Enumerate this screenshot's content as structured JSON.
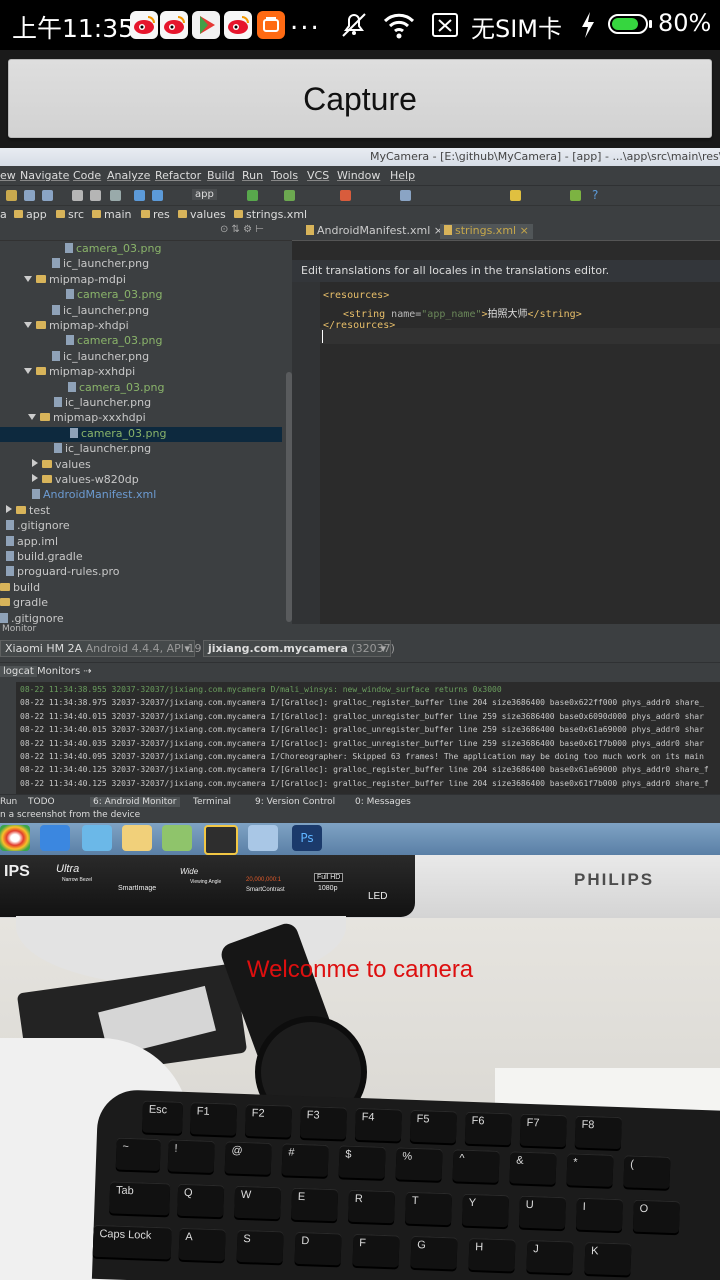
{
  "status_bar": {
    "time": "上午11:35",
    "notification_icons": [
      "weibo-icon",
      "weibo-icon",
      "play-store-icon",
      "weibo-icon",
      "taobao-icon"
    ],
    "overflow_dots": "...",
    "sim_status": "无SIM卡",
    "battery_percent": "80%",
    "battery_level": 0.8,
    "battery_color": "#36d63f"
  },
  "capture_button": {
    "label": "Capture"
  },
  "camera_overlay": {
    "text": "Welconme to camera",
    "color": "#dd0f0f"
  },
  "preview": {
    "ide": {
      "window_title": "MyCamera - [E:\\github\\MyCamera] - [app] - ...\\app\\src\\main\\res\\",
      "menu": [
        "ew",
        "Navigate",
        "Code",
        "Analyze",
        "Refactor",
        "Build",
        "Run",
        "Tools",
        "VCS",
        "Window",
        "Help"
      ],
      "toolbar_app": "app",
      "breadcrumb": [
        "a",
        "app",
        "src",
        "main",
        "res",
        "values",
        "strings.xml"
      ],
      "project_tree": [
        {
          "label": "camera_03.png",
          "type": "file",
          "highlight": true
        },
        {
          "label": "ic_launcher.png",
          "type": "file"
        },
        {
          "label": "mipmap-mdpi",
          "type": "folder-open"
        },
        {
          "label": "camera_03.png",
          "type": "file",
          "highlight": true
        },
        {
          "label": "ic_launcher.png",
          "type": "file"
        },
        {
          "label": "mipmap-xhdpi",
          "type": "folder-open"
        },
        {
          "label": "camera_03.png",
          "type": "file",
          "highlight": true
        },
        {
          "label": "ic_launcher.png",
          "type": "file"
        },
        {
          "label": "mipmap-xxhdpi",
          "type": "folder-open"
        },
        {
          "label": "camera_03.png",
          "type": "file",
          "highlight": true
        },
        {
          "label": "ic_launcher.png",
          "type": "file"
        },
        {
          "label": "mipmap-xxxhdpi",
          "type": "folder-open"
        },
        {
          "label": "camera_03.png",
          "type": "file",
          "highlight": true,
          "selected": true
        },
        {
          "label": "ic_launcher.png",
          "type": "file"
        },
        {
          "label": "values",
          "type": "folder-closed"
        },
        {
          "label": "values-w820dp",
          "type": "folder-closed"
        },
        {
          "label": "AndroidManifest.xml",
          "type": "file",
          "blue": true
        },
        {
          "label": "test",
          "type": "folder-closed"
        },
        {
          "label": ".gitignore",
          "type": "file"
        },
        {
          "label": "app.iml",
          "type": "file"
        },
        {
          "label": "build.gradle",
          "type": "file"
        },
        {
          "label": "proguard-rules.pro",
          "type": "file"
        },
        {
          "label": "build",
          "type": "folder"
        },
        {
          "label": "gradle",
          "type": "folder"
        },
        {
          "label": ".gitignore",
          "type": "file"
        }
      ],
      "editor_tabs": [
        "AndroidManifest.xml",
        "strings.xml"
      ],
      "translation_banner": "Edit translations for all locales in the translations editor.",
      "code": {
        "line1": "<resources>",
        "line2_open": "<string",
        "line2_attr": " name=",
        "line2_val": "\"app_name\"",
        "line2_close": ">",
        "line2_text": "拍照大师",
        "line2_end": "</string>",
        "line3": "</resources>"
      },
      "monitor_title": "Monitor",
      "device": "Xiaomi HM 2A",
      "device_detail": "Android 4.4.4, API 19",
      "process": "jixiang.com.mycamera",
      "process_pid": "(32037)",
      "logcat_tabs": [
        "logcat",
        "Monitors"
      ],
      "log_lines": [
        "08-22 11:34:38.955 32037-32037/jixiang.com.mycamera D/mali_winsys: new_window_surface returns 0x3000",
        "08-22 11:34:38.975 32037-32037/jixiang.com.mycamera I/[Gralloc]: gralloc_register_buffer line 204 size3686400 base0x622ff000 phys_addr0 share_",
        "08-22 11:34:40.015 32037-32037/jixiang.com.mycamera I/[Gralloc]: gralloc_unregister_buffer line 259 size3686400 base0x6090d000 phys_addr0 shar",
        "08-22 11:34:40.015 32037-32037/jixiang.com.mycamera I/[Gralloc]: gralloc_unregister_buffer line 259 size3686400 base0x61a69000 phys_addr0 shar",
        "08-22 11:34:40.035 32037-32037/jixiang.com.mycamera I/[Gralloc]: gralloc_unregister_buffer line 259 size3686400 base0x61f7b000 phys_addr0 shar",
        "08-22 11:34:40.095 32037-32037/jixiang.com.mycamera I/Choreographer: Skipped 63 frames!  The application may be doing too much work on its main",
        "08-22 11:34:40.125 32037-32037/jixiang.com.mycamera I/[Gralloc]: gralloc_register_buffer line 204 size3686400 base0x61a69000 phys_addr0 share_f",
        "08-22 11:34:40.125 32037-32037/jixiang.com.mycamera I/[Gralloc]: gralloc_register_buffer line 204 size3686400 base0x61f7b000 phys_addr0 share_f"
      ],
      "bottom_tabs": [
        "Run",
        "TODO",
        "6: Android Monitor",
        "Terminal",
        "9: Version Control",
        "0: Messages"
      ],
      "status_line": "n a screenshot from the device"
    },
    "monitor_logos": {
      "ips": "IPS",
      "ultra": "Ultra",
      "ultra_sub": "Narrow Bezel",
      "smartimage": "SmartImage",
      "wide": "Wide",
      "wide_sub": "Viewing Angle",
      "contrast": "20,000,000:1",
      "smartcontrast": "SmartContrast",
      "fullhd": "Full HD",
      "fullhd_res": "1080p",
      "led": "LED",
      "brand": "PHILIPS"
    },
    "keyboard_keys": [
      "Esc",
      "F1",
      "F2",
      "F3",
      "F4",
      "F5",
      "F6",
      "F7",
      "F8",
      "~",
      "!",
      "@",
      "#",
      "$",
      "%",
      "^",
      "&",
      "*",
      "(",
      "Tab",
      "Q",
      "W",
      "E",
      "R",
      "T",
      "Y",
      "U",
      "I",
      "O",
      "Caps Lock",
      "A",
      "S",
      "D",
      "F",
      "G",
      "H",
      "J",
      "K"
    ]
  }
}
